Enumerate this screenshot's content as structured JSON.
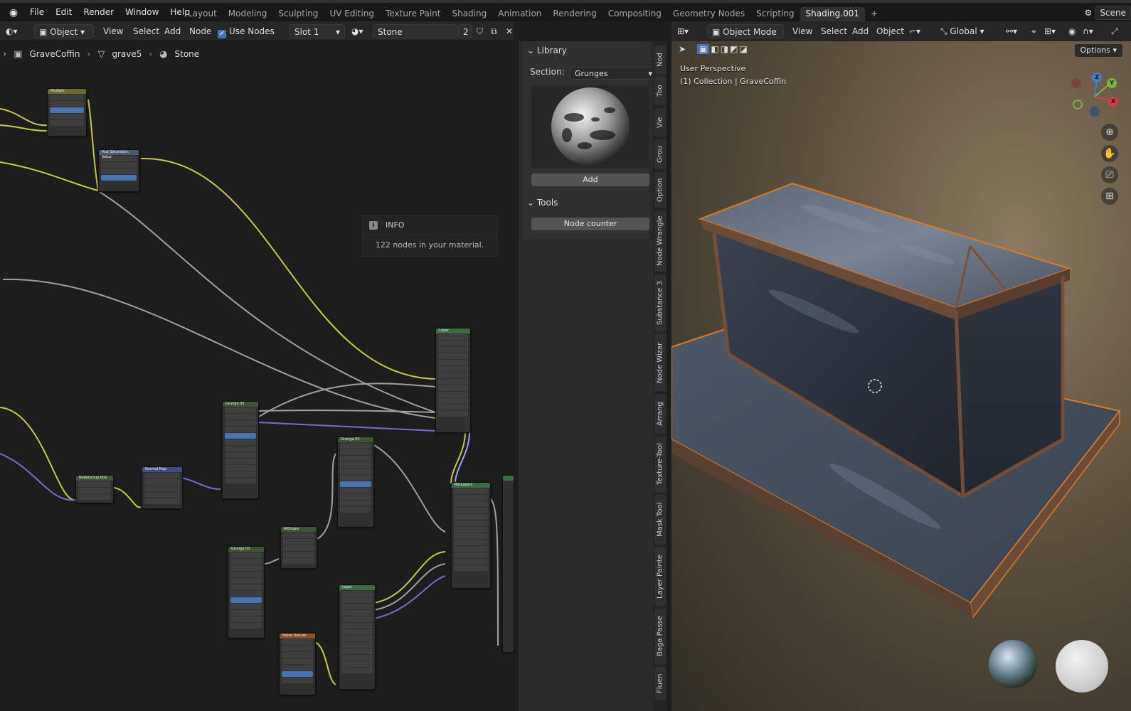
{
  "topbar": {
    "menus": [
      "File",
      "Edit",
      "Render",
      "Window",
      "Help"
    ],
    "workspaces": [
      "Layout",
      "Modeling",
      "Sculpting",
      "UV Editing",
      "Texture Paint",
      "Shading",
      "Animation",
      "Rendering",
      "Compositing",
      "Geometry Nodes",
      "Scripting",
      "Shading.001"
    ],
    "active_workspace": "Shading.001",
    "add_tab": "+",
    "scene": "Scene"
  },
  "node_header": {
    "mode": "Object",
    "view": "View",
    "select": "Select",
    "add": "Add",
    "node": "Node",
    "use_nodes": "Use Nodes",
    "slot": "Slot 1",
    "material": "Stone",
    "users": "2"
  },
  "breadcrumb": {
    "object": "GraveCoffin",
    "mesh": "grave5",
    "material": "Stone"
  },
  "info": {
    "title": "INFO",
    "message": "122 nodes in your material."
  },
  "library": {
    "title": "Library",
    "section_label": "Section:",
    "section_value": "Grunges",
    "add": "Add"
  },
  "tools": {
    "title": "Tools",
    "node_counter": "Node counter"
  },
  "vertical_tabs": [
    "Nod",
    "Too",
    "Vie",
    "Grou",
    "Option",
    "Node Wrangle",
    "Substance 3",
    "Node Wizar",
    "Arrang",
    "Texture-Tool",
    "Mask Tool",
    "Layer Painte",
    "Baga Passe",
    "Fluen"
  ],
  "viewport_header": {
    "mode": "Object Mode",
    "view": "View",
    "select": "Select",
    "add": "Add",
    "object": "Object",
    "orientation": "Global",
    "options": "Options"
  },
  "viewport": {
    "perspective": "User Perspective",
    "collection": "(1) Collection | GraveCoffin"
  },
  "nodes": [
    {
      "title": "Multiply",
      "kind": "mix"
    },
    {
      "title": "Hue Saturation Value",
      "kind": "conv"
    },
    {
      "title": "Layer",
      "kind": "shader"
    },
    {
      "title": "Grunge 05",
      "kind": "grp"
    },
    {
      "title": "Grunge 03",
      "kind": "grp"
    },
    {
      "title": "NodeGroup.002",
      "kind": "grp"
    },
    {
      "title": "Normal Map",
      "kind": "vec"
    },
    {
      "title": "AllEdges",
      "kind": "grp"
    },
    {
      "title": "Grunge 03",
      "kind": "grp"
    },
    {
      "title": "MixLayers",
      "kind": "shader"
    },
    {
      "title": "Layer",
      "kind": "shader"
    },
    {
      "title": "Noise Texture",
      "kind": "tex"
    }
  ]
}
